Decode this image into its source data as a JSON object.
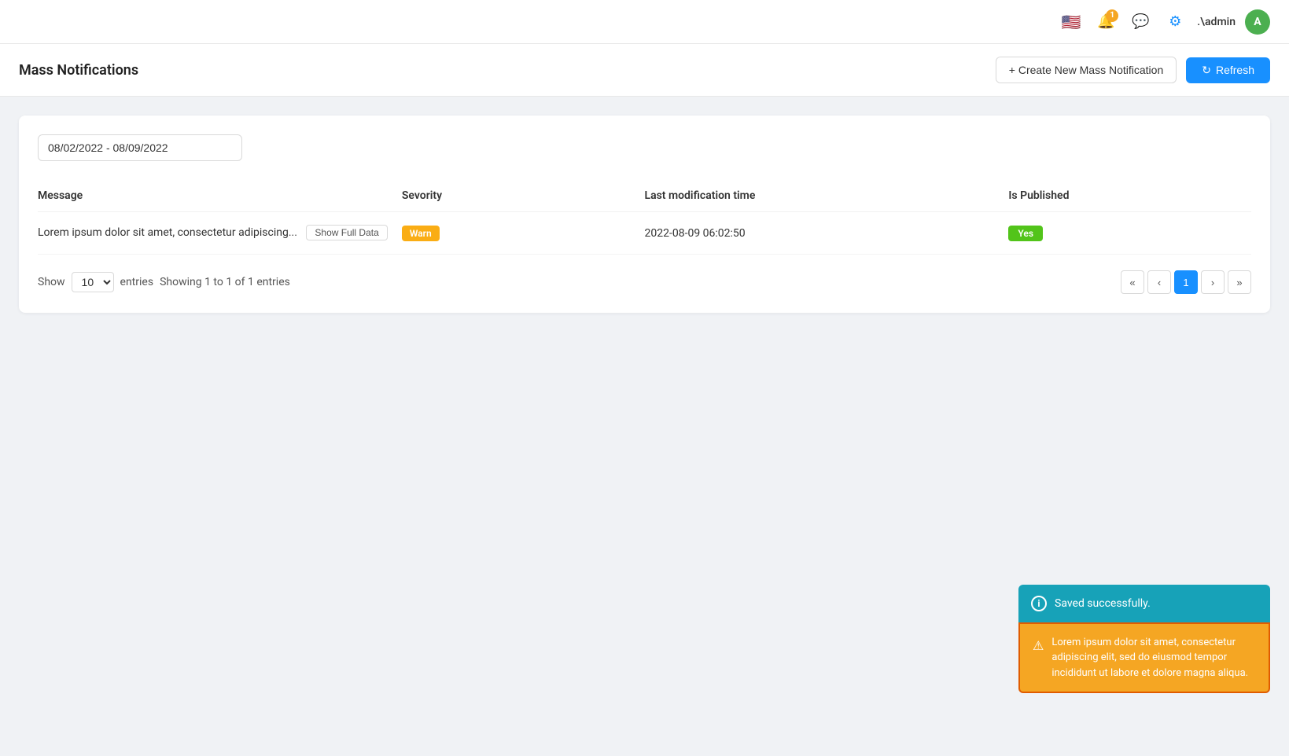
{
  "navbar": {
    "flag": "🇺🇸",
    "notification_badge": "1",
    "admin_label": ".\\admin",
    "avatar_letter": "A"
  },
  "header": {
    "title": "Mass Notifications",
    "create_button_label": "+ Create New Mass Notification",
    "refresh_button_label": "Refresh"
  },
  "filters": {
    "date_range": "08/02/2022 - 08/09/2022"
  },
  "table": {
    "columns": {
      "message": "Message",
      "severity": "Sevority",
      "last_modification_time": "Last modification time",
      "is_published": "Is Published"
    },
    "rows": [
      {
        "message_preview": "Lorem ipsum dolor sit amet, consectetur adipiscing...",
        "show_full_data_label": "Show Full Data",
        "severity": "Warn",
        "severity_color": "#faad14",
        "last_modification_time": "2022-08-09 06:02:50",
        "is_published": "Yes",
        "is_published_color": "#52c41a"
      }
    ]
  },
  "pagination": {
    "show_label": "Show",
    "entries_select_value": "10",
    "entries_label": "entries",
    "entries_info": "Showing 1 to 1 of 1 entries",
    "current_page": 1,
    "buttons": [
      "«",
      "‹",
      "1",
      "›",
      "»"
    ]
  },
  "toasts": {
    "success": {
      "icon": "i",
      "message": "Saved successfully."
    },
    "warning": {
      "icon": "⚠",
      "message": "Lorem ipsum dolor sit amet, consectetur adipiscing elit, sed do eiusmod tempor incididunt ut labore et dolore magna aliqua."
    }
  }
}
